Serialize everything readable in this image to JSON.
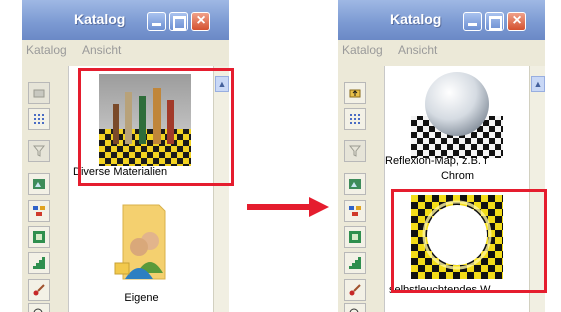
{
  "left_window": {
    "title": "Katalog",
    "menu": [
      "Katalog",
      "Ansicht"
    ],
    "items": [
      {
        "label": "Diverse Materialien",
        "selected": true
      },
      {
        "label": "Eigene",
        "selected": false
      }
    ]
  },
  "right_window": {
    "title": "Katalog",
    "menu": [
      "Katalog",
      "Ansicht"
    ],
    "items": [
      {
        "label": "Reflexion-Map, z.B. f",
        "label2": "Chrom",
        "selected": false
      },
      {
        "label": "selbstleuchtendes W",
        "selected": true
      }
    ]
  },
  "toolbar_icons": [
    "folder-icon",
    "grid-view-icon",
    "filter-icon",
    "image-icon",
    "network-icon",
    "landscape-icon",
    "stairs-icon",
    "brush-icon",
    "zoom-icon"
  ],
  "colors": {
    "highlight": "#e51d2e",
    "arrow": "#e51d2e",
    "titlebar": "#7d9bd3"
  }
}
